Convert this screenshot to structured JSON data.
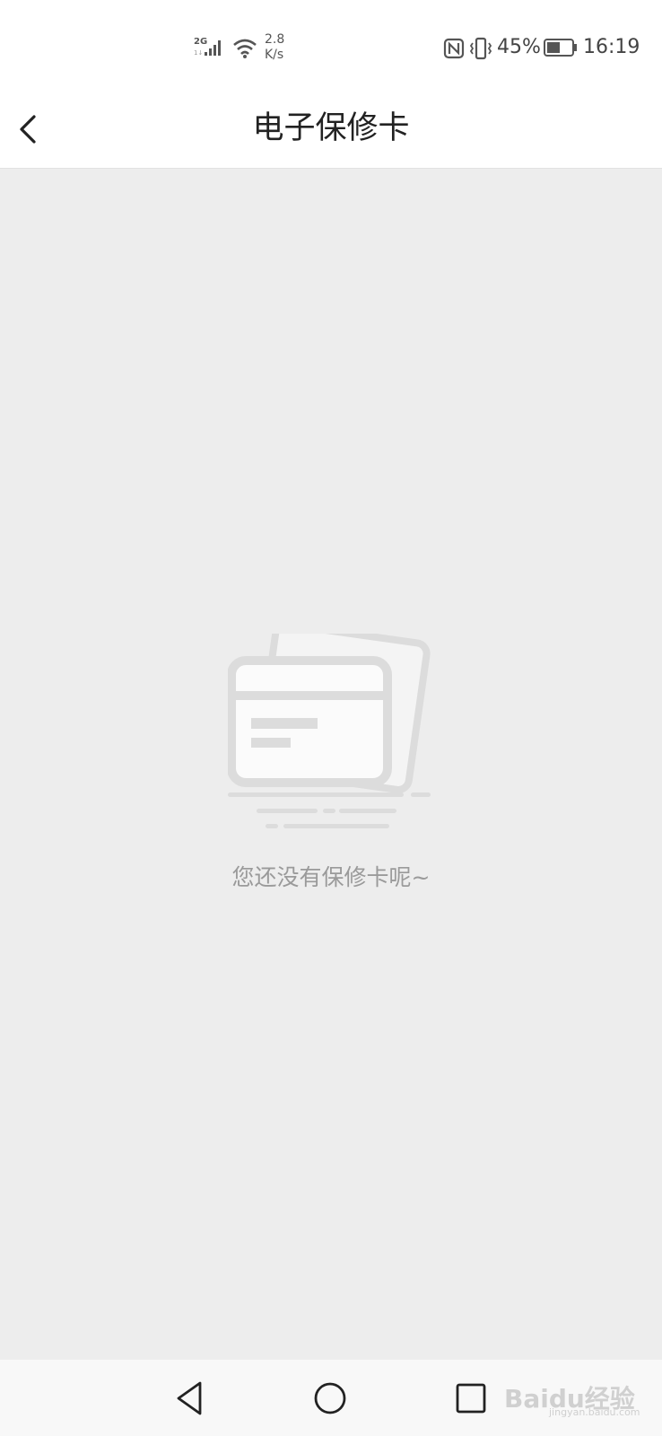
{
  "status_bar": {
    "network": "2G",
    "speed_value": "2.8",
    "speed_unit": "K/s",
    "battery_percent": "45%",
    "time": "16:19",
    "icons": [
      "signal-icon",
      "wifi-icon",
      "nfc-icon",
      "vibrate-icon",
      "battery-icon"
    ]
  },
  "header": {
    "title": "电子保修卡",
    "back_icon": "chevron-left-icon"
  },
  "empty_state": {
    "icon": "cards-icon",
    "message": "您还没有保修卡呢~"
  },
  "nav_bar": {
    "back_icon": "triangle-back-icon",
    "home_icon": "circle-home-icon",
    "recent_icon": "square-recent-icon"
  },
  "watermark": {
    "brand": "Baidu经验",
    "url": "jingyan.baidu.com"
  },
  "colors": {
    "background": "#ededed",
    "bar_background": "#ffffff",
    "title_text": "#222222",
    "empty_text": "#9a9a9a",
    "illustration": "#dcdcdc"
  }
}
